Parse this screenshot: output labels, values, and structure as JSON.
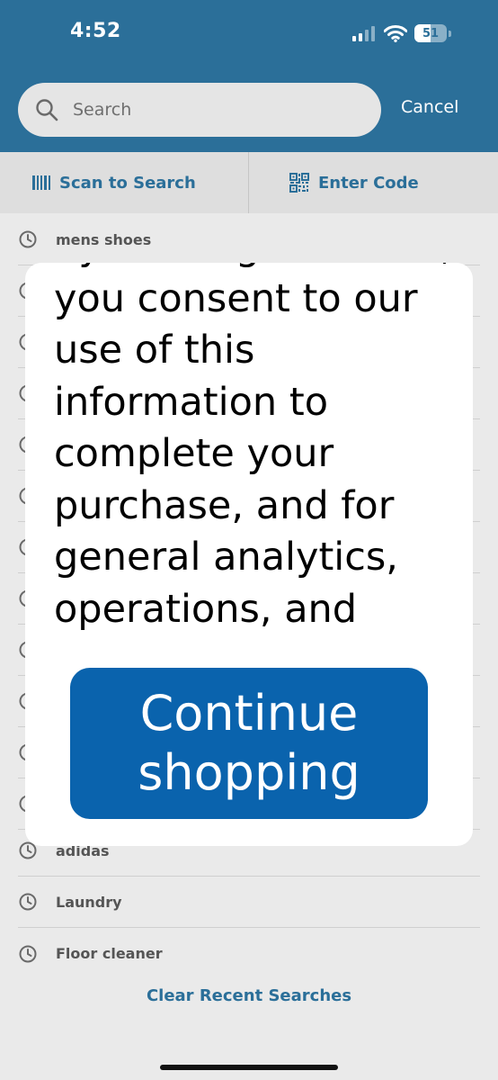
{
  "status_bar": {
    "time": "4:52",
    "battery": "51"
  },
  "search": {
    "placeholder": "Search",
    "cancel_label": "Cancel"
  },
  "actions": {
    "scan_label": "Scan to Search",
    "code_label": "Enter Code"
  },
  "recent_searches": {
    "items": [
      {
        "label": "mens shoes"
      },
      {
        "label": ""
      },
      {
        "label": ""
      },
      {
        "label": ""
      },
      {
        "label": ""
      },
      {
        "label": ""
      },
      {
        "label": ""
      },
      {
        "label": ""
      },
      {
        "label": ""
      },
      {
        "label": ""
      },
      {
        "label": ""
      },
      {
        "label": ""
      },
      {
        "label": "adidas"
      },
      {
        "label": "Laundry"
      },
      {
        "label": "Floor cleaner"
      }
    ],
    "clear_label": "Clear Recent Searches"
  },
  "modal": {
    "body_text": "by clicking continue, you consent to our use of this information to complete your purchase, and for general analytics, operations, and fraud prevention.",
    "continue_label": "Continue shopping"
  },
  "colors": {
    "brand_blue": "#2b6f99",
    "button_blue": "#0a63ad",
    "background": "#eaeaea"
  },
  "icons": {
    "search": "magnifier-icon",
    "scan": "barcode-icon",
    "code": "qr-code-icon",
    "recent": "clock-icon"
  }
}
